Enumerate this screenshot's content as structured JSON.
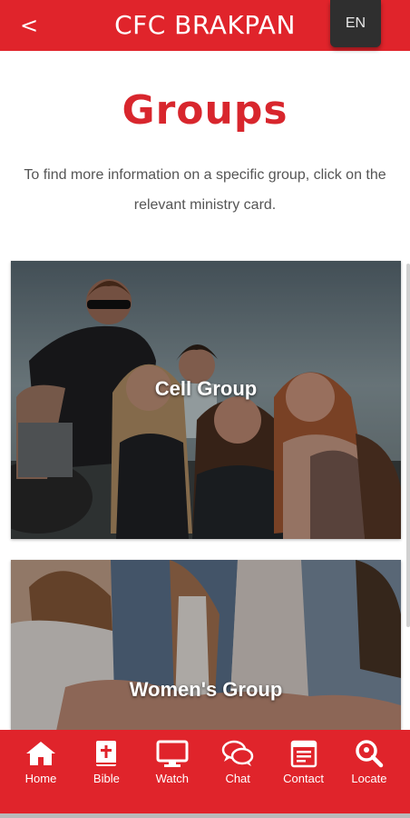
{
  "header": {
    "back_label": "<",
    "title": "CFC BRAKPAN",
    "language": "EN"
  },
  "page": {
    "heading": "Groups",
    "intro": "To find more information on a specific group, click on the relevant ministry card."
  },
  "cards": [
    {
      "label": "Cell Group"
    },
    {
      "label": "Women's Group"
    }
  ],
  "bottom_nav": {
    "items": [
      {
        "label": "Home",
        "icon": "home-icon"
      },
      {
        "label": "Bible",
        "icon": "bible-icon"
      },
      {
        "label": "Watch",
        "icon": "monitor-icon"
      },
      {
        "label": "Chat",
        "icon": "chat-icon"
      },
      {
        "label": "Contact",
        "icon": "contact-card-icon"
      },
      {
        "label": "Locate",
        "icon": "map-search-icon"
      }
    ]
  },
  "colors": {
    "brand_red": "#e0242b",
    "heading_red": "#d8262d",
    "language_button": "#2f2f2f",
    "body_text": "#555555"
  }
}
